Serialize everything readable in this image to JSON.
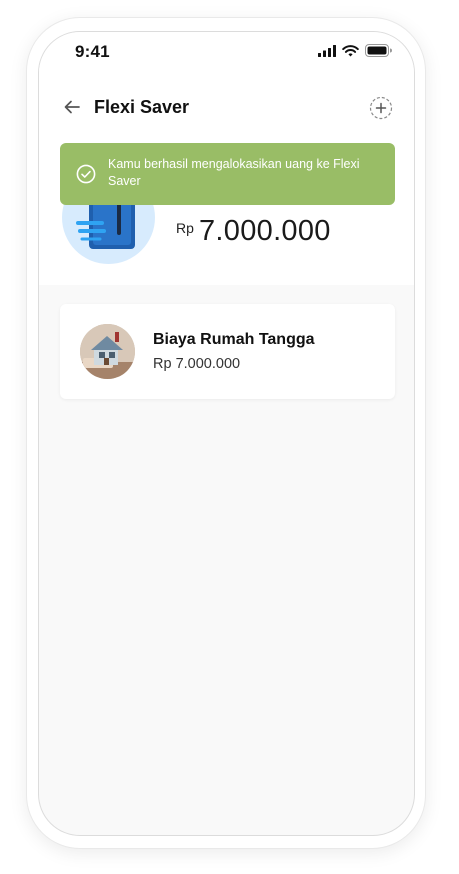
{
  "status_bar": {
    "time": "9:41"
  },
  "header": {
    "title": "Flexi Saver",
    "back_icon": "arrow-left-icon",
    "add_icon": "plus-circle-dashed-icon"
  },
  "toast": {
    "message": "Kamu berhasil mengalokasikan uang ke Flexi Saver",
    "icon": "check-circle-icon",
    "color": "#99bd66"
  },
  "balance": {
    "currency": "Rp",
    "amount": "7.000.000",
    "icon": "wallet-icon"
  },
  "goals": [
    {
      "name": "Biaya Rumah Tangga",
      "amount": "Rp 7.000.000",
      "image": "house-photo"
    }
  ],
  "colors": {
    "toast_green": "#99bd66",
    "balance_circle": "#d7ebfd",
    "wallet_blue": "#1f6fc4",
    "background": "#f9f9f9"
  }
}
